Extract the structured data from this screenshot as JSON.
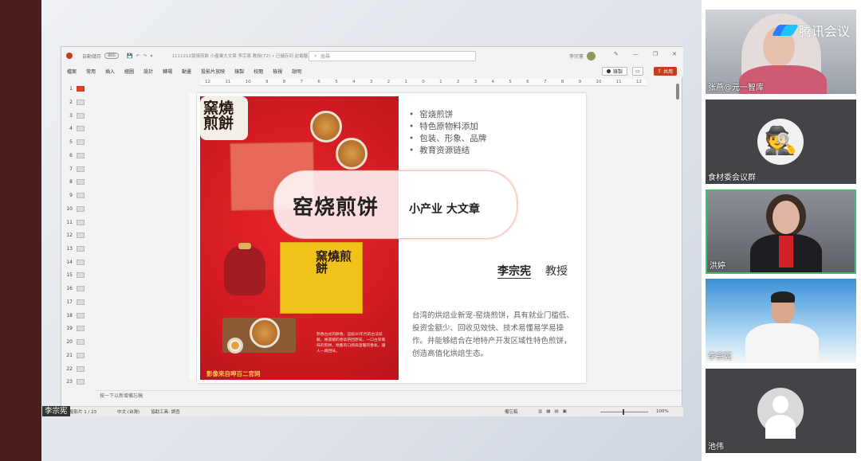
{
  "ppt": {
    "autosave_label": "自動儲存",
    "autosave_state": "關閉",
    "doc_title": "1111212窯燒煎餅 小產業大文章 李宗憲 教授(72) • 已儲存到 此電腦 ∨",
    "search_placeholder": "搜尋",
    "user_name": "李宗憲",
    "menu": [
      "檔案",
      "常用",
      "插入",
      "繪圖",
      "設計",
      "轉場",
      "動畫",
      "投影片放映",
      "錄製",
      "校閱",
      "檢視",
      "說明"
    ],
    "record_label": "錄製",
    "share_label": "共用",
    "ruler_ticks": [
      "12",
      "11",
      "10",
      "9",
      "8",
      "7",
      "6",
      "5",
      "4",
      "3",
      "2",
      "1",
      "0",
      "1",
      "2",
      "3",
      "4",
      "5",
      "6",
      "7",
      "8",
      "9",
      "10",
      "11",
      "12"
    ],
    "thumbnails": [
      "1",
      "2",
      "3",
      "4",
      "5",
      "6",
      "7",
      "8",
      "9",
      "10",
      "11",
      "12",
      "13",
      "14",
      "15",
      "16",
      "17",
      "18",
      "19",
      "20",
      "21",
      "22",
      "23"
    ],
    "notes_placeholder": "按一下以新增備忘稿",
    "status": {
      "slide": "投影片 1 / 23",
      "language": "中文 (台灣)",
      "accessibility": "協助工具: 調查",
      "notes": "備忘稿",
      "zoom": "100%"
    }
  },
  "slide": {
    "photo_title": "窯燒煎餅",
    "box_title": "窯燒煎餅",
    "poem": "熟香古式的餅香，這段80年代的古法技藝，將濃郁的香氣帶回原味。一口古早風味的煎餅，懷舊的口感與溫暖的香氣，讓人一再回味。",
    "photo_credit": "影像來自呷百二官网",
    "bullets": [
      "窑烧煎饼",
      "特色原物料添加",
      "包装、形象、品牌",
      "教育资源链结"
    ],
    "main_title": "窑烧煎饼",
    "subtitle": "小产业 大文章",
    "author_name": "李宗宪",
    "author_title": "教授",
    "description": "台湾的烘焙业新宠-窑烧煎饼，具有就业门槛低、投资金额少、回收见效快、技术易懂易学易操作。并能够结合在地特产开发区域性特色煎饼，创造高值化烘焙生态。"
  },
  "meeting": {
    "app_name": "腾讯会议",
    "speaker_label": "李宗宪",
    "participants": [
      {
        "name": "张燕@元一智库"
      },
      {
        "name": "食材委会议群"
      },
      {
        "name": "洪婷"
      },
      {
        "name": "李宗宪"
      },
      {
        "name": "池伟"
      }
    ]
  },
  "colors": {
    "ppt_accent": "#c43e1c",
    "active_speaker": "#39c16c",
    "photo_red": "#d51c23"
  }
}
